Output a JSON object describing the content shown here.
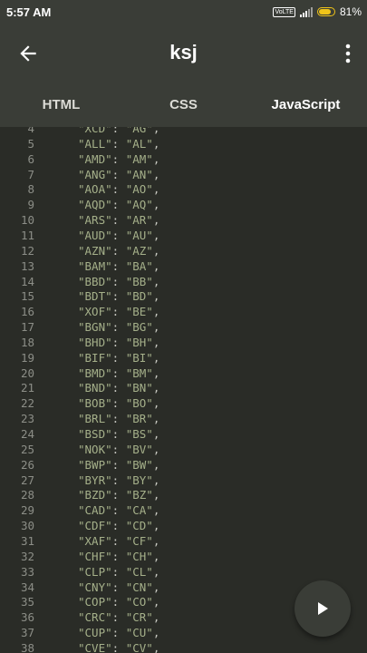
{
  "status": {
    "time": "5:57 AM",
    "volte": "VoLTE",
    "battery": "81%"
  },
  "appbar": {
    "title": "ksj"
  },
  "tabs": [
    {
      "label": "HTML"
    },
    {
      "label": "CSS"
    },
    {
      "label": "JavaScript"
    }
  ],
  "active_tab": "JavaScript",
  "editor": {
    "lines": [
      {
        "n": "4",
        "k": "XCD",
        "v": "AG"
      },
      {
        "n": "5",
        "k": "ALL",
        "v": "AL"
      },
      {
        "n": "6",
        "k": "AMD",
        "v": "AM"
      },
      {
        "n": "7",
        "k": "ANG",
        "v": "AN"
      },
      {
        "n": "8",
        "k": "AOA",
        "v": "AO"
      },
      {
        "n": "9",
        "k": "AQD",
        "v": "AQ"
      },
      {
        "n": "10",
        "k": "ARS",
        "v": "AR"
      },
      {
        "n": "11",
        "k": "AUD",
        "v": "AU"
      },
      {
        "n": "12",
        "k": "AZN",
        "v": "AZ"
      },
      {
        "n": "13",
        "k": "BAM",
        "v": "BA"
      },
      {
        "n": "14",
        "k": "BBD",
        "v": "BB"
      },
      {
        "n": "15",
        "k": "BDT",
        "v": "BD"
      },
      {
        "n": "16",
        "k": "XOF",
        "v": "BE"
      },
      {
        "n": "17",
        "k": "BGN",
        "v": "BG"
      },
      {
        "n": "18",
        "k": "BHD",
        "v": "BH"
      },
      {
        "n": "19",
        "k": "BIF",
        "v": "BI"
      },
      {
        "n": "20",
        "k": "BMD",
        "v": "BM"
      },
      {
        "n": "21",
        "k": "BND",
        "v": "BN"
      },
      {
        "n": "22",
        "k": "BOB",
        "v": "BO"
      },
      {
        "n": "23",
        "k": "BRL",
        "v": "BR"
      },
      {
        "n": "24",
        "k": "BSD",
        "v": "BS"
      },
      {
        "n": "25",
        "k": "NOK",
        "v": "BV"
      },
      {
        "n": "26",
        "k": "BWP",
        "v": "BW"
      },
      {
        "n": "27",
        "k": "BYR",
        "v": "BY"
      },
      {
        "n": "28",
        "k": "BZD",
        "v": "BZ"
      },
      {
        "n": "29",
        "k": "CAD",
        "v": "CA"
      },
      {
        "n": "30",
        "k": "CDF",
        "v": "CD"
      },
      {
        "n": "31",
        "k": "XAF",
        "v": "CF"
      },
      {
        "n": "32",
        "k": "CHF",
        "v": "CH"
      },
      {
        "n": "33",
        "k": "CLP",
        "v": "CL"
      },
      {
        "n": "34",
        "k": "CNY",
        "v": "CN"
      },
      {
        "n": "35",
        "k": "COP",
        "v": "CO"
      },
      {
        "n": "36",
        "k": "CRC",
        "v": "CR"
      },
      {
        "n": "37",
        "k": "CUP",
        "v": "CU"
      },
      {
        "n": "38",
        "k": "CVE",
        "v": "CV"
      }
    ]
  },
  "fab": {
    "icon": "play-icon"
  }
}
